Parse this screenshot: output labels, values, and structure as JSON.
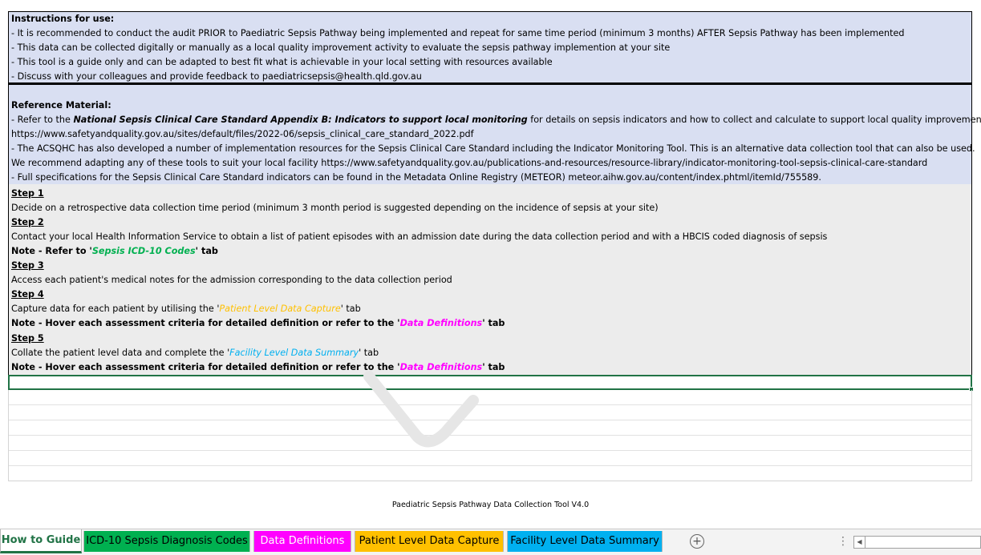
{
  "instructions": {
    "heading": "Instructions for use:",
    "lines": [
      "- It is recommended to conduct the audit PRIOR to Paediatric Sepsis Pathway being implemented and repeat for same time period (minimum 3 months) AFTER Sepsis Pathway has been implemented",
      "- This data can be collected digitally or manually as a local quality improvement activity to evaluate the sepsis pathway implemention at your site",
      "- This tool is a guide only and can be adapted to best fit what is achievable in your local setting with resources available",
      "- Discuss with your colleagues and provide feedback to paediatricsepsis@health.qld.gov.au"
    ]
  },
  "reference": {
    "heading": "Reference Material:",
    "line1_prefix": "- Refer to the ",
    "line1_emph": "National Sepsis Clinical Care Standard Appendix B: Indicators to support local monitoring",
    "line1_suffix": "  for details on sepsis indicators and how to collect and calculate to support local quality improvement activities",
    "line2": "https://www.safetyandquality.gov.au/sites/default/files/2022-06/sepsis_clinical_care_standard_2022.pdf",
    "line3": "- The ACSQHC has also developed a number of implementation resources for the Sepsis Clinical Care Standard including the Indicator Monitoring Tool. This is an alternative data collection tool that can also be used.",
    "line4": "We recommend adapting any of these tools to suit your local facility  https://www.safetyandquality.gov.au/publications-and-resources/resource-library/indicator-monitoring-tool-sepsis-clinical-care-standard",
    "line5": "- Full specifications for the Sepsis Clinical Care Standard indicators can be found in the Metadata Online Registry (METEOR) meteor.aihw.gov.au/content/index.phtml/itemId/755589."
  },
  "steps": {
    "step1_title": "Step 1",
    "step1_text": "Decide on a retrospective data collection time period (minimum 3 month period is suggested depending on the incidence of sepsis at your site)",
    "step2_title": "Step 2",
    "step2_text": "Contact your local Health Information Service to obtain a list of patient episodes with an admission date during the data collection period and with a HBCIS coded diagnosis of sepsis",
    "step2_note_prefix": "Note - Refer to '",
    "step2_note_link": "Sepsis ICD-10 Codes",
    "step2_note_suffix": "' tab",
    "step3_title": "Step 3",
    "step3_text": "Access each patient's medical notes for the admission corresponding to the data collection period",
    "step4_title": "Step 4",
    "step4_text_prefix": "Capture data for each patient by utilising the '",
    "step4_text_link": "Patient Level Data Capture",
    "step4_text_suffix": "' tab",
    "step4_note_prefix": "Note - Hover each assessment criteria for detailed definition or refer to the '",
    "step4_note_link": "Data Definitions",
    "step4_note_suffix": "' tab",
    "step5_title": "Step 5",
    "step5_text_prefix": "Collate the patient level data and complete the '",
    "step5_text_link": "Facility Level Data Summary",
    "step5_text_suffix": "' tab",
    "step5_note_prefix": "Note - Hover each assessment criteria for detailed definition or refer to the '",
    "step5_note_link": "Data Definitions",
    "step5_note_suffix": "' tab"
  },
  "footer": "Paediatric Sepsis Pathway Data Collection Tool V4.0",
  "tabs": [
    {
      "label": "How to Guide",
      "color": "#ffffff",
      "active": true
    },
    {
      "label": "ICD-10 Sepsis Diagnosis Codes",
      "color": "#00b050",
      "active": false
    },
    {
      "label": "Data Definitions",
      "color": "#ff00ff",
      "active": false
    },
    {
      "label": "Patient Level Data Capture",
      "color": "#ffc000",
      "active": false
    },
    {
      "label": "Facility Level Data Summary",
      "color": "#00b0f0",
      "active": false
    }
  ],
  "tabbar": {
    "add_sheet_icon": "plus-circle-icon",
    "more_icon": "vertical-ellipsis-icon",
    "scroll_left_icon": "triangle-left-icon"
  }
}
